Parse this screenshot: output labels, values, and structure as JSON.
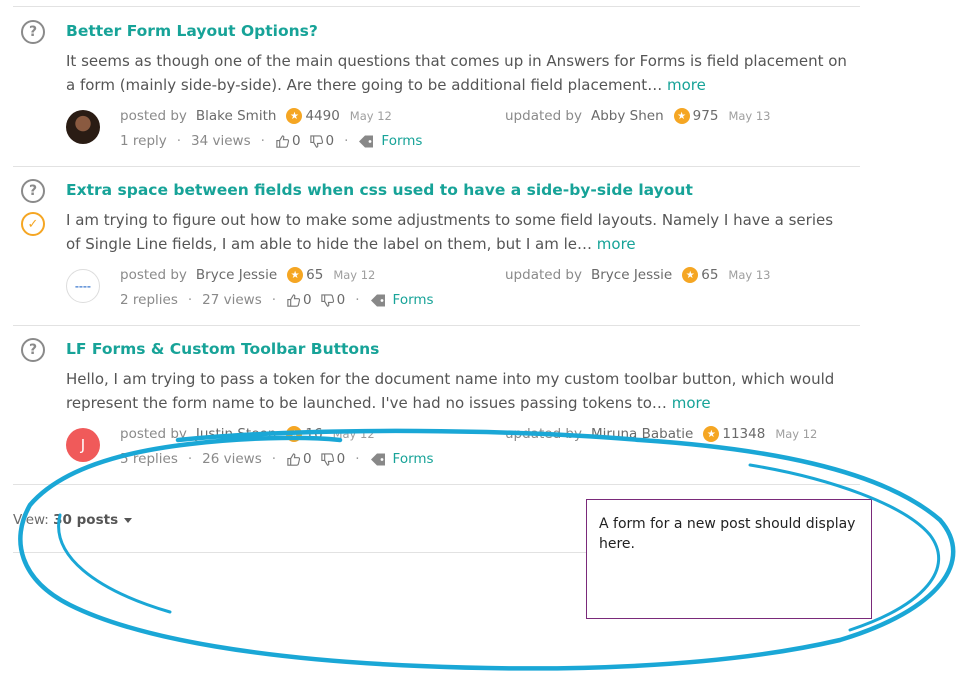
{
  "posts": [
    {
      "title": "Better Form Layout Options?",
      "excerpt": "It seems as though one of the main questions that comes up in Answers for Forms is field placement on a form (mainly side-by-side). Are there going to be additional field placement…",
      "more": "more",
      "posted_label": "posted by",
      "author": "Blake Smith",
      "author_rep": "4490",
      "posted_date": "May 12",
      "updated_label": "updated by",
      "updater": "Abby Shen",
      "updater_rep": "975",
      "updated_date": "May 13",
      "replies": "1 reply",
      "views": "34 views",
      "upvotes": "0",
      "downvotes": "0",
      "tag": "Forms",
      "answered": false
    },
    {
      "title": "Extra space between fields when css used to have a side-by-side layout",
      "excerpt": "I am trying to figure out how to make some adjustments to some field layouts.   Namely I have a series of Single Line fields, I am able to hide the label on them, but I am le…",
      "more": "more",
      "posted_label": "posted by",
      "author": "Bryce Jessie",
      "author_rep": "65",
      "posted_date": "May 12",
      "updated_label": "updated by",
      "updater": "Bryce Jessie",
      "updater_rep": "65",
      "updated_date": "May 13",
      "replies": "2 replies",
      "views": "27 views",
      "upvotes": "0",
      "downvotes": "0",
      "tag": "Forms",
      "answered": true
    },
    {
      "title": "LF Forms & Custom Toolbar Buttons",
      "excerpt": "Hello,  I am trying to pass a token for the document name into my custom toolbar button, which would represent the form name to be launched. I've had no issues passing tokens to…",
      "more": "more",
      "posted_label": "posted by",
      "author": "Justin Steen",
      "author_initial": "J",
      "author_rep": "16",
      "posted_date": "May 12",
      "updated_label": "updated by",
      "updater": "Miruna Babatie",
      "updater_rep": "11348",
      "updated_date": "May 12",
      "replies": "5 replies",
      "views": "26 views",
      "upvotes": "0",
      "downvotes": "0",
      "tag": "Forms",
      "answered": false
    }
  ],
  "view": {
    "label": "View:",
    "value": "30 posts"
  },
  "note": {
    "text": "A form for a new post should display here."
  },
  "colors": {
    "accent": "#17a398",
    "star": "#f5a623",
    "annotation": "#1aa7d6",
    "note_border": "#7a2a7a"
  },
  "icons": [
    "question-icon",
    "check-circle-icon",
    "star-icon",
    "thumbs-up-icon",
    "thumbs-down-icon",
    "tag-icon",
    "caret-down-icon"
  ]
}
